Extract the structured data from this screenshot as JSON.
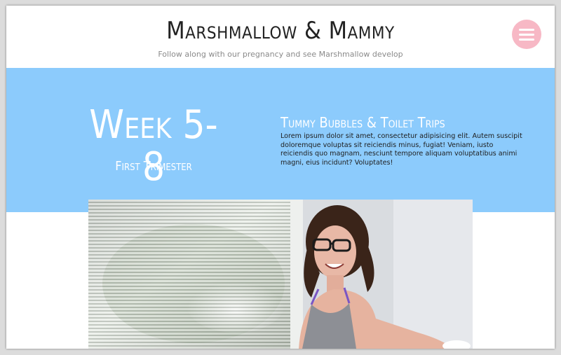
{
  "site": {
    "title": "Marshmallow & Mammy",
    "tagline": "Follow along with our pregnancy and see Marshmallow develop"
  },
  "nav": {
    "menu_icon": "hamburger-menu-icon"
  },
  "hero": {
    "week": "Week 5-8",
    "trimester": "First Trimester",
    "post_title": "Tummy Bubbles & Toilet Trips",
    "post_excerpt": "Lorem ipsum dolor sit amet, consectetur adipisicing elit. Autem suscipit doloremque voluptas sit reiciendis minus, fugiat! Veniam, iusto reiciendis quo magnam, nesciunt tempore aliquam voluptatibus animi magni, eius incidunt? Voluptates!"
  },
  "colors": {
    "hero_background": "#8ccbfc",
    "menu_button": "#f7b8c5",
    "page_background": "#ffffff"
  }
}
